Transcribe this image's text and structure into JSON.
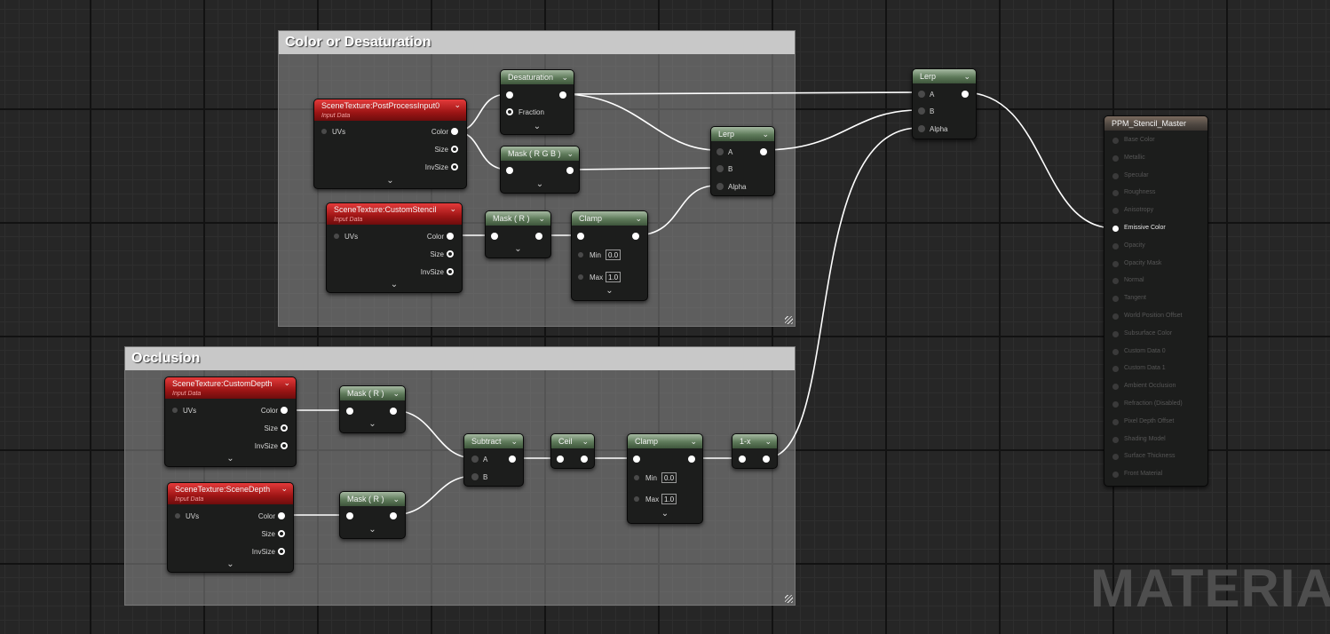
{
  "comments": {
    "color": {
      "title": "Color or Desaturation"
    },
    "occlusion": {
      "title": "Occlusion"
    }
  },
  "nodes": {
    "scene_ppi": {
      "title": "SceneTexture:PostProcessInput0",
      "subtitle": "Input Data",
      "in_uvs": "UVs",
      "out_color": "Color",
      "out_size": "Size",
      "out_invsize": "InvSize"
    },
    "scene_stencil": {
      "title": "SceneTexture:CustomStencil",
      "subtitle": "Input Data",
      "in_uvs": "UVs",
      "out_color": "Color",
      "out_size": "Size",
      "out_invsize": "InvSize"
    },
    "desaturation": {
      "title": "Desaturation",
      "fraction": "Fraction"
    },
    "mask_rgb": {
      "title": "Mask ( R G B )"
    },
    "mask_r_top": {
      "title": "Mask ( R )"
    },
    "clamp_top": {
      "title": "Clamp",
      "min_label": "Min",
      "min_value": "0.0",
      "max_label": "Max",
      "max_value": "1.0"
    },
    "lerp_inner": {
      "title": "Lerp",
      "a": "A",
      "b": "B",
      "alpha": "Alpha"
    },
    "lerp_outer": {
      "title": "Lerp",
      "a": "A",
      "b": "B",
      "alpha": "Alpha"
    },
    "scene_cdepth": {
      "title": "SceneTexture:CustomDepth",
      "subtitle": "Input Data",
      "in_uvs": "UVs",
      "out_color": "Color",
      "out_size": "Size",
      "out_invsize": "InvSize"
    },
    "scene_sdepth": {
      "title": "SceneTexture:SceneDepth",
      "subtitle": "Input Data",
      "in_uvs": "UVs",
      "out_color": "Color",
      "out_size": "Size",
      "out_invsize": "InvSize"
    },
    "mask_r_1": {
      "title": "Mask ( R )"
    },
    "mask_r_2": {
      "title": "Mask ( R )"
    },
    "subtract": {
      "title": "Subtract",
      "a": "A",
      "b": "B"
    },
    "ceil": {
      "title": "Ceil"
    },
    "clamp_bot": {
      "title": "Clamp",
      "min_label": "Min",
      "min_value": "0.0",
      "max_label": "Max",
      "max_value": "1.0"
    },
    "one_minus": {
      "title": "1-x"
    }
  },
  "master": {
    "title": "PPM_Stencil_Master",
    "inputs": [
      "Base Color",
      "Metallic",
      "Specular",
      "Roughness",
      "Anisotropy",
      "Emissive Color",
      "Opacity",
      "Opacity Mask",
      "Normal",
      "Tangent",
      "World Position Offset",
      "Subsurface Color",
      "Custom Data 0",
      "Custom Data 1",
      "Ambient Occlusion",
      "Refraction (Disabled)",
      "Pixel Depth Offset",
      "Shading Model",
      "Surface Thickness",
      "Front Material"
    ]
  },
  "watermark": "MATERIAL",
  "colors": {
    "wire": "#ffffff",
    "green_header": "#5e7a5a",
    "red_header": "#9e1515",
    "comment_header": "#c8c8c8"
  }
}
